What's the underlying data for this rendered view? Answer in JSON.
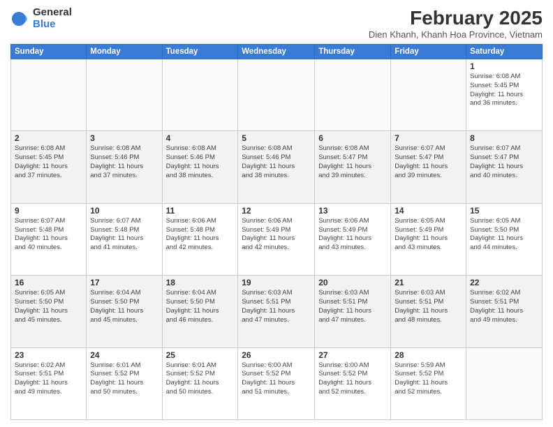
{
  "logo": {
    "general": "General",
    "blue": "Blue"
  },
  "title": {
    "month_year": "February 2025",
    "location": "Dien Khanh, Khanh Hoa Province, Vietnam"
  },
  "weekdays": [
    "Sunday",
    "Monday",
    "Tuesday",
    "Wednesday",
    "Thursday",
    "Friday",
    "Saturday"
  ],
  "weeks": [
    [
      {
        "day": "",
        "info": ""
      },
      {
        "day": "",
        "info": ""
      },
      {
        "day": "",
        "info": ""
      },
      {
        "day": "",
        "info": ""
      },
      {
        "day": "",
        "info": ""
      },
      {
        "day": "",
        "info": ""
      },
      {
        "day": "1",
        "info": "Sunrise: 6:08 AM\nSunset: 5:45 PM\nDaylight: 11 hours\nand 36 minutes."
      }
    ],
    [
      {
        "day": "2",
        "info": "Sunrise: 6:08 AM\nSunset: 5:45 PM\nDaylight: 11 hours\nand 37 minutes."
      },
      {
        "day": "3",
        "info": "Sunrise: 6:08 AM\nSunset: 5:46 PM\nDaylight: 11 hours\nand 37 minutes."
      },
      {
        "day": "4",
        "info": "Sunrise: 6:08 AM\nSunset: 5:46 PM\nDaylight: 11 hours\nand 38 minutes."
      },
      {
        "day": "5",
        "info": "Sunrise: 6:08 AM\nSunset: 5:46 PM\nDaylight: 11 hours\nand 38 minutes."
      },
      {
        "day": "6",
        "info": "Sunrise: 6:08 AM\nSunset: 5:47 PM\nDaylight: 11 hours\nand 39 minutes."
      },
      {
        "day": "7",
        "info": "Sunrise: 6:07 AM\nSunset: 5:47 PM\nDaylight: 11 hours\nand 39 minutes."
      },
      {
        "day": "8",
        "info": "Sunrise: 6:07 AM\nSunset: 5:47 PM\nDaylight: 11 hours\nand 40 minutes."
      }
    ],
    [
      {
        "day": "9",
        "info": "Sunrise: 6:07 AM\nSunset: 5:48 PM\nDaylight: 11 hours\nand 40 minutes."
      },
      {
        "day": "10",
        "info": "Sunrise: 6:07 AM\nSunset: 5:48 PM\nDaylight: 11 hours\nand 41 minutes."
      },
      {
        "day": "11",
        "info": "Sunrise: 6:06 AM\nSunset: 5:48 PM\nDaylight: 11 hours\nand 42 minutes."
      },
      {
        "day": "12",
        "info": "Sunrise: 6:06 AM\nSunset: 5:49 PM\nDaylight: 11 hours\nand 42 minutes."
      },
      {
        "day": "13",
        "info": "Sunrise: 6:06 AM\nSunset: 5:49 PM\nDaylight: 11 hours\nand 43 minutes."
      },
      {
        "day": "14",
        "info": "Sunrise: 6:05 AM\nSunset: 5:49 PM\nDaylight: 11 hours\nand 43 minutes."
      },
      {
        "day": "15",
        "info": "Sunrise: 6:05 AM\nSunset: 5:50 PM\nDaylight: 11 hours\nand 44 minutes."
      }
    ],
    [
      {
        "day": "16",
        "info": "Sunrise: 6:05 AM\nSunset: 5:50 PM\nDaylight: 11 hours\nand 45 minutes."
      },
      {
        "day": "17",
        "info": "Sunrise: 6:04 AM\nSunset: 5:50 PM\nDaylight: 11 hours\nand 45 minutes."
      },
      {
        "day": "18",
        "info": "Sunrise: 6:04 AM\nSunset: 5:50 PM\nDaylight: 11 hours\nand 46 minutes."
      },
      {
        "day": "19",
        "info": "Sunrise: 6:03 AM\nSunset: 5:51 PM\nDaylight: 11 hours\nand 47 minutes."
      },
      {
        "day": "20",
        "info": "Sunrise: 6:03 AM\nSunset: 5:51 PM\nDaylight: 11 hours\nand 47 minutes."
      },
      {
        "day": "21",
        "info": "Sunrise: 6:03 AM\nSunset: 5:51 PM\nDaylight: 11 hours\nand 48 minutes."
      },
      {
        "day": "22",
        "info": "Sunrise: 6:02 AM\nSunset: 5:51 PM\nDaylight: 11 hours\nand 49 minutes."
      }
    ],
    [
      {
        "day": "23",
        "info": "Sunrise: 6:02 AM\nSunset: 5:51 PM\nDaylight: 11 hours\nand 49 minutes."
      },
      {
        "day": "24",
        "info": "Sunrise: 6:01 AM\nSunset: 5:52 PM\nDaylight: 11 hours\nand 50 minutes."
      },
      {
        "day": "25",
        "info": "Sunrise: 6:01 AM\nSunset: 5:52 PM\nDaylight: 11 hours\nand 50 minutes."
      },
      {
        "day": "26",
        "info": "Sunrise: 6:00 AM\nSunset: 5:52 PM\nDaylight: 11 hours\nand 51 minutes."
      },
      {
        "day": "27",
        "info": "Sunrise: 6:00 AM\nSunset: 5:52 PM\nDaylight: 11 hours\nand 52 minutes."
      },
      {
        "day": "28",
        "info": "Sunrise: 5:59 AM\nSunset: 5:52 PM\nDaylight: 11 hours\nand 52 minutes."
      },
      {
        "day": "",
        "info": ""
      }
    ]
  ]
}
